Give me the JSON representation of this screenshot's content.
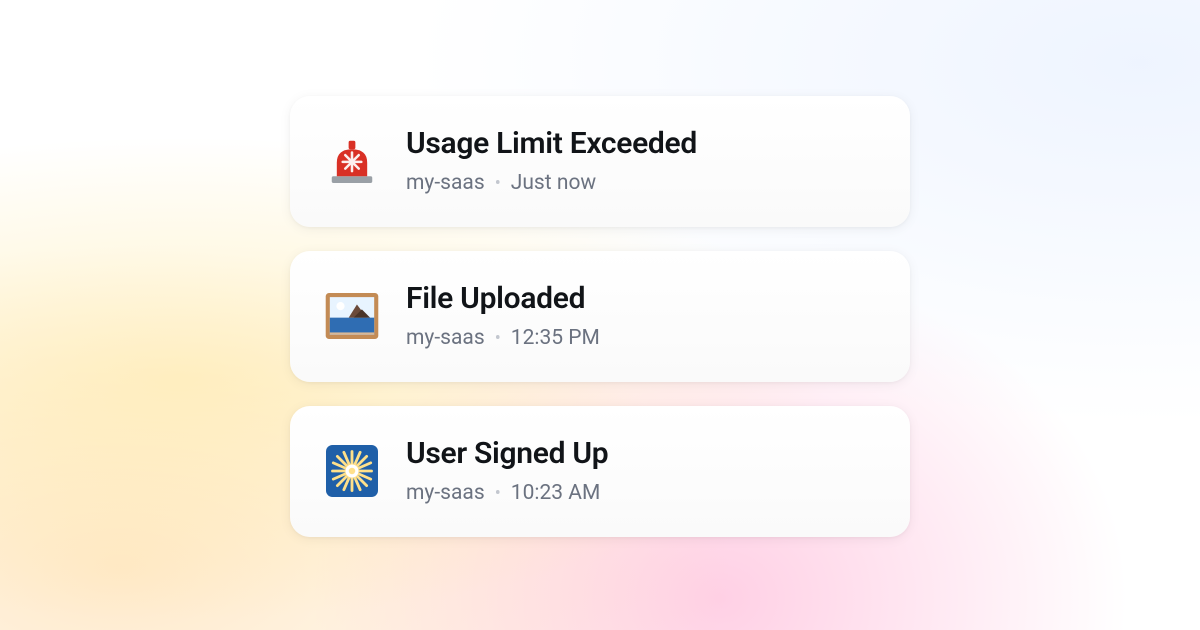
{
  "notifications": [
    {
      "icon": "siren-icon",
      "title": "Usage Limit Exceeded",
      "source": "my-saas",
      "time": "Just now"
    },
    {
      "icon": "framed-picture-icon",
      "title": "File Uploaded",
      "source": "my-saas",
      "time": "12:35 PM"
    },
    {
      "icon": "sparkle-burst-icon",
      "title": "User Signed Up",
      "source": "my-saas",
      "time": "10:23 AM"
    }
  ]
}
